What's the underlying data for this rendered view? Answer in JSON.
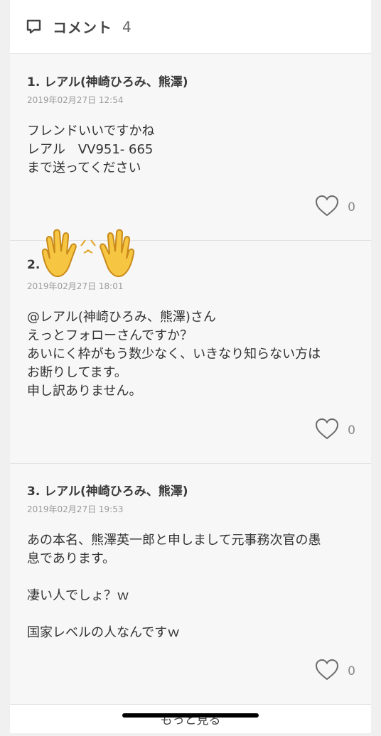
{
  "header": {
    "title": "コメント",
    "count": "4",
    "icon": "comment-icon"
  },
  "comments": [
    {
      "author": "1. レアル(神崎ひろみ、熊澤)",
      "date": "2019年02月27日 12:54",
      "body": "フレンドいいですかね\nレアル　VV951- 665\nまで送ってください",
      "likes": "0"
    },
    {
      "author": "2.",
      "date": "2019年02月27日 18:01",
      "body": "@レアル(神崎ひろみ、熊澤)さん\nえっとフォローさんですか？\nあいにく枠がもう数少なく、いきなり知らない方は\nお断りしてます。\n申し訳ありません。",
      "likes": "0"
    },
    {
      "author": "3. レアル(神崎ひろみ、熊澤)",
      "date": "2019年02月27日 19:53",
      "body": "あの本名、熊澤英一郎と申しまして元事務次官の愚\n息であります。\n\n凄い人でしょ？ｗ\n\n国家レベルの人なんですｗ",
      "likes": "0"
    }
  ],
  "more_label": "もっと見る",
  "overlay": {
    "icon": "raised-hands-emoji"
  },
  "colors": {
    "background": "#f6f6f6",
    "header_bg": "#ffffff",
    "text": "#333333",
    "muted": "#9a9a9a"
  }
}
